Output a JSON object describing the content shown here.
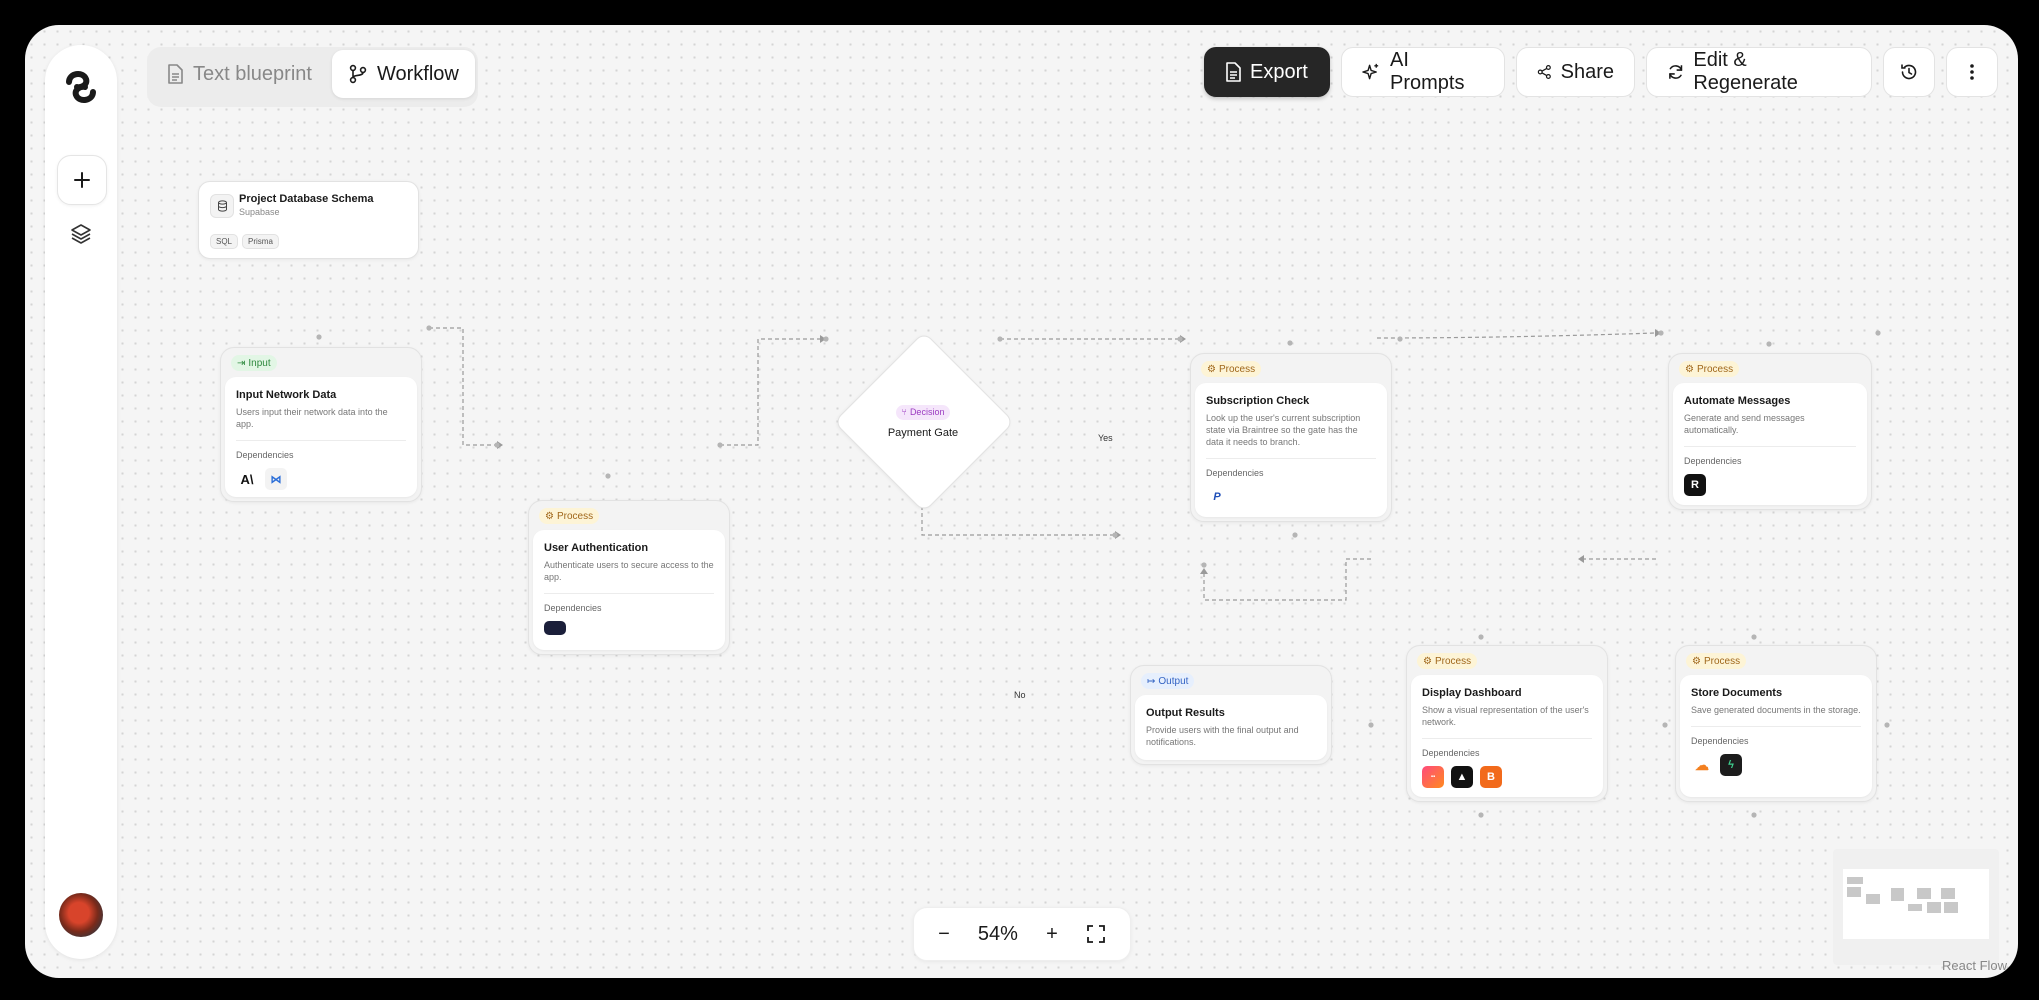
{
  "view_toggle": {
    "text_blueprint": "Text blueprint",
    "workflow": "Workflow",
    "active": "Workflow"
  },
  "toolbar": {
    "export": "Export",
    "ai_prompts": "AI Prompts",
    "share": "Share",
    "edit_regenerate": "Edit & Regenerate"
  },
  "schema_card": {
    "title": "Project Database Schema",
    "subtitle": "Supabase",
    "tags": [
      "SQL",
      "Prisma"
    ]
  },
  "dependencies_label": "Dependencies",
  "nodes": {
    "input_network": {
      "badge": "Input",
      "title": "Input Network Data",
      "desc": "Users input their network data into the app."
    },
    "user_auth": {
      "badge": "Process",
      "title": "User Authentication",
      "desc": "Authenticate users to secure access to the app."
    },
    "payment_gate": {
      "badge": "Decision",
      "title": "Payment Gate"
    },
    "subscription": {
      "badge": "Process",
      "title": "Subscription Check",
      "desc": "Look up the user's current subscription state via Braintree so the gate has the data it needs to branch."
    },
    "automate": {
      "badge": "Process",
      "title": "Automate Messages",
      "desc": "Generate and send messages automatically."
    },
    "output": {
      "badge": "Output",
      "title": "Output Results",
      "desc": "Provide users with the final output and notifications."
    },
    "dashboard": {
      "badge": "Process",
      "title": "Display Dashboard",
      "desc": "Show a visual representation of the user's network."
    },
    "store": {
      "badge": "Process",
      "title": "Store Documents",
      "desc": "Save generated documents in the storage."
    }
  },
  "edge_labels": {
    "yes": "Yes",
    "no": "No"
  },
  "zoom": {
    "level": "54%",
    "minus": "−",
    "plus": "+"
  },
  "attribution": "React Flow",
  "colors": {
    "export_bg": "#262626",
    "canvas_bg": "#f5f5f5",
    "process_badge": "#a0671b",
    "input_badge": "#2f8a3f",
    "output_badge": "#3464c4",
    "decision_badge": "#9b3bc1"
  }
}
